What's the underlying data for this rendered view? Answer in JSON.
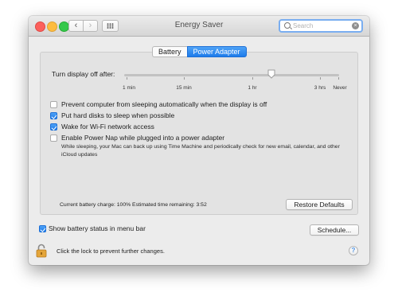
{
  "window": {
    "title": "Energy Saver"
  },
  "toolbar": {
    "back_glyph": "‹",
    "forward_glyph": "›"
  },
  "search": {
    "placeholder": "Search",
    "value": "",
    "clear_glyph": "×"
  },
  "tabs": [
    {
      "label": "Battery",
      "active": false
    },
    {
      "label": "Power Adapter",
      "active": true
    }
  ],
  "slider": {
    "label": "Turn display off after:",
    "ticks": [
      "1 min",
      "15 min",
      "1 hr",
      "3 hrs",
      "Never"
    ],
    "selected": "1 hr"
  },
  "options": [
    {
      "label": "Prevent computer from sleeping automatically when the display is off",
      "checked": false
    },
    {
      "label": "Put hard disks to sleep when possible",
      "checked": true
    },
    {
      "label": "Wake for Wi-Fi network access",
      "checked": true
    },
    {
      "label": "Enable Power Nap while plugged into a power adapter",
      "checked": false
    }
  ],
  "power_nap_description": "While sleeping, your Mac can back up using Time Machine and periodically check for new email, calendar, and other iCloud updates",
  "battery_status": "Current battery charge: 100%  Estimated time remaining: 3:52",
  "buttons": {
    "restore_defaults": "Restore Defaults",
    "schedule": "Schedule..."
  },
  "show_battery": {
    "label": "Show battery status in menu bar",
    "checked": true
  },
  "lock": {
    "text": "Click the lock to prevent further changes."
  },
  "help": {
    "glyph": "?"
  },
  "colors": {
    "accent": "#1d7bea",
    "window_bg": "#ececec",
    "panel_bg": "#e3e3e3"
  }
}
